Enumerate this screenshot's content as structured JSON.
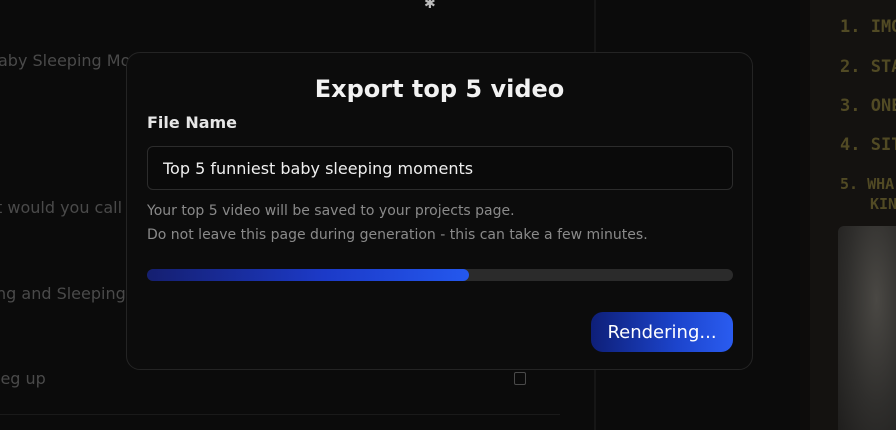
{
  "background": {
    "lines": [
      "aby Sleeping Mo",
      "t would you call",
      "ng and Sleeping",
      " leg up"
    ],
    "side_list": [
      {
        "num": "1.",
        "text": "IMO"
      },
      {
        "num": "2.",
        "text": "STA"
      },
      {
        "num": "3.",
        "text": "ONE"
      },
      {
        "num": "4.",
        "text": "SIT"
      },
      {
        "num": "5.",
        "text": "WHA",
        "cont": "KIN"
      }
    ]
  },
  "modal": {
    "title": "Export top 5 video",
    "field_label": "File Name",
    "file_name": "Top 5 funniest baby sleeping moments",
    "info_line_1": "Your top 5 video will be saved to your projects page.",
    "info_line_2": "Do not leave this page during generation - this can take a few minutes.",
    "progress": 0.55,
    "button_label": "Rendering..."
  },
  "colors": {
    "accent": "#1c44cc",
    "modal_bg": "#0c0c0c",
    "page_bg": "#0b0b0b"
  }
}
